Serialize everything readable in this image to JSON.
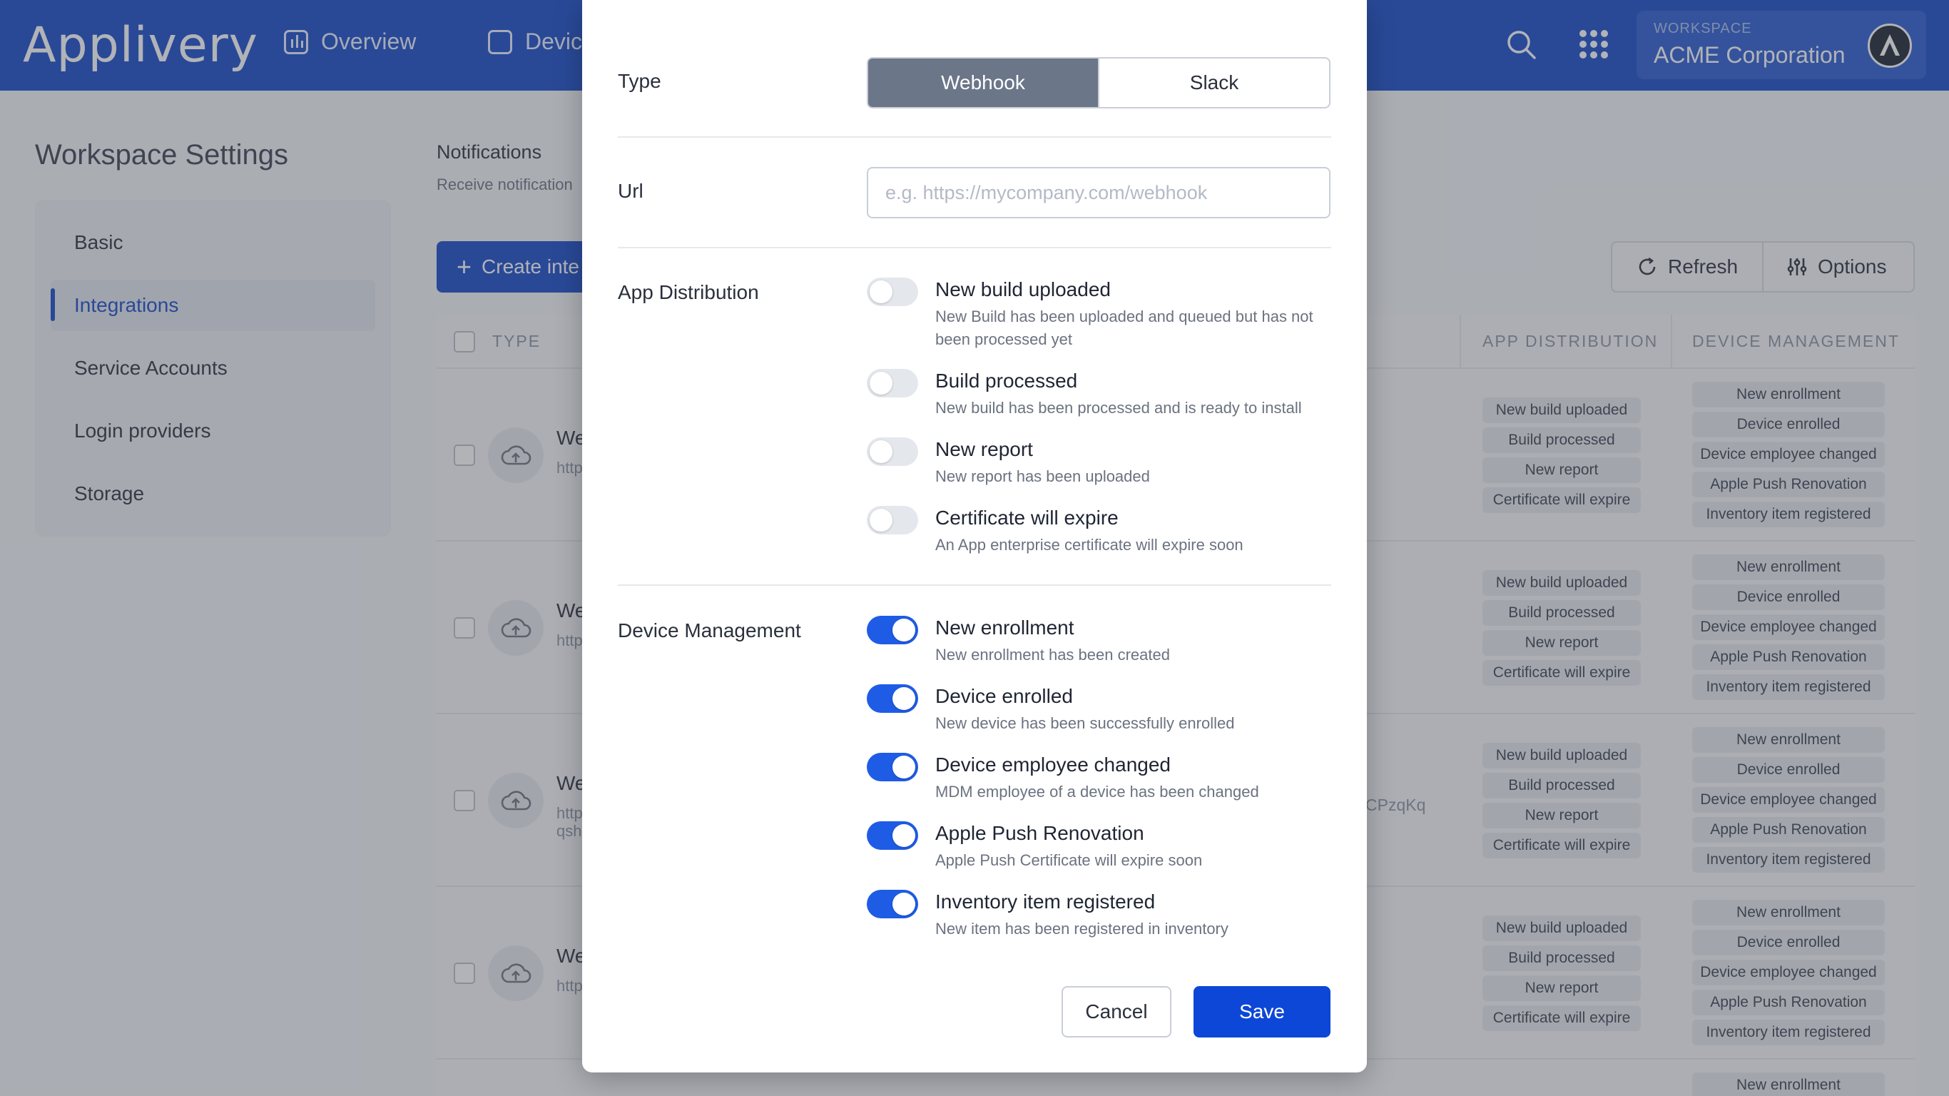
{
  "header": {
    "logo": "Applivery",
    "nav": [
      {
        "label": "Overview"
      },
      {
        "label": "Devices"
      }
    ],
    "workspace_label": "WORKSPACE",
    "workspace_name": "ACME Corporation"
  },
  "sidebar": {
    "title": "Workspace Settings",
    "items": [
      {
        "label": "Basic"
      },
      {
        "label": "Integrations"
      },
      {
        "label": "Service Accounts"
      },
      {
        "label": "Login providers"
      },
      {
        "label": "Storage"
      }
    ]
  },
  "main": {
    "title": "Notifications",
    "subtitle": "Receive notification",
    "create_button": "Create inte",
    "refresh_button": "Refresh",
    "options_button": "Options",
    "columns": {
      "type": "TYPE",
      "app_distribution": "APP DISTRIBUTION",
      "device_management": "DEVICE MANAGEMENT"
    },
    "rows": [
      {
        "name": "We",
        "url": "http"
      },
      {
        "name": "We",
        "url": "http"
      },
      {
        "name": "We",
        "url": "http",
        "url2": "qsh"
      },
      {
        "name": "We",
        "url": "http"
      }
    ],
    "partial_text": "CPzqKq",
    "app_tags": [
      "New build uploaded",
      "Build processed",
      "New report",
      "Certificate will expire"
    ],
    "device_tags": [
      "New enrollment",
      "Device enrolled",
      "Device employee changed",
      "Apple Push Renovation",
      "Inventory item registered"
    ],
    "last_row_tag": "New enrollment"
  },
  "modal": {
    "type_label": "Type",
    "type_options": [
      "Webhook",
      "Slack"
    ],
    "url_label": "Url",
    "url_placeholder": "e.g. https://mycompany.com/webhook",
    "app_distribution_label": "App Distribution",
    "app_options": [
      {
        "title": "New build uploaded",
        "desc": "New Build has been uploaded and queued but has not been processed yet",
        "on": false
      },
      {
        "title": "Build processed",
        "desc": "New build has been processed and is ready to install",
        "on": false
      },
      {
        "title": "New report",
        "desc": "New report has been uploaded",
        "on": false
      },
      {
        "title": "Certificate will expire",
        "desc": "An App enterprise certificate will expire soon",
        "on": false
      }
    ],
    "device_management_label": "Device Management",
    "device_options": [
      {
        "title": "New enrollment",
        "desc": "New enrollment has been created",
        "on": true
      },
      {
        "title": "Device enrolled",
        "desc": "New device has been successfully enrolled",
        "on": true
      },
      {
        "title": "Device employee changed",
        "desc": "MDM employee of a device has been changed",
        "on": true
      },
      {
        "title": "Apple Push Renovation",
        "desc": "Apple Push Certificate will expire soon",
        "on": true
      },
      {
        "title": "Inventory item registered",
        "desc": "New item has been registered in inventory",
        "on": true
      }
    ],
    "cancel_label": "Cancel",
    "save_label": "Save"
  },
  "colors": {
    "brand": "#1549c9",
    "toggle_on": "#1f5ce6",
    "save": "#0d47d8"
  }
}
